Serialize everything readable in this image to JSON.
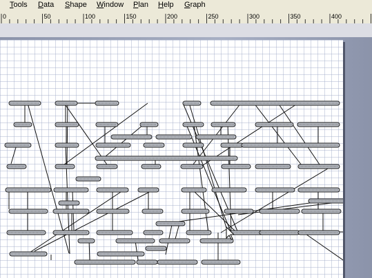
{
  "menu": {
    "items": [
      "Tools",
      "Data",
      "Shape",
      "Window",
      "Plan",
      "Help",
      "Graph"
    ],
    "underlined": [
      "T",
      "D",
      "S",
      "W",
      "P",
      "H",
      "G"
    ]
  },
  "ruler": {
    "labels": [
      "0",
      "50",
      "100",
      "150",
      "200",
      "250",
      "300",
      "350",
      "400"
    ]
  },
  "colors": {
    "menubar": "#ece9d8",
    "workspace": "#8a93a8",
    "page": "#ffffff",
    "grid": "#a0aac8",
    "bar_fill": "#b8bcc4",
    "bar_border": "#222222",
    "connector": "#111111"
  },
  "icons": {
    "cursor": "mouse-pointer-icon",
    "selection_handle": "selection-handle-icon"
  }
}
